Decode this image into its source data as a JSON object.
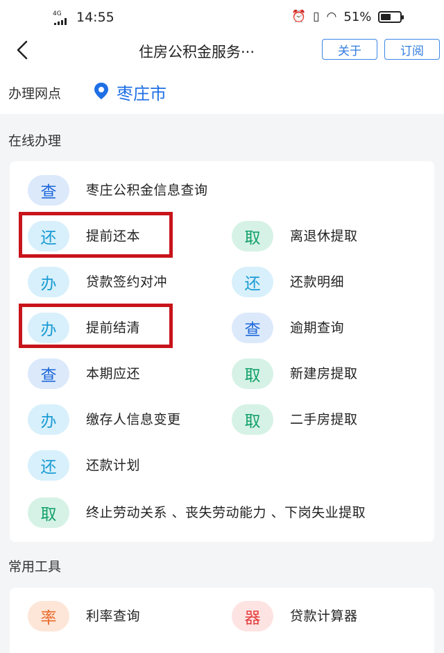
{
  "status_bar": {
    "time": "14:55",
    "network": "4G",
    "battery": "51%"
  },
  "nav": {
    "title": "住房公积金服务···",
    "about_label": "关于",
    "subscribe_label": "订阅"
  },
  "location": {
    "label": "办理网点",
    "city": "枣庄市"
  },
  "online": {
    "section_title": "在线办理",
    "items": [
      {
        "badge": "查",
        "label": "枣庄公积金信息查询"
      },
      {
        "badge": "还",
        "label": "提前还本"
      },
      {
        "badge": "取",
        "label": "离退休提取"
      },
      {
        "badge": "办",
        "label": "贷款签约对冲"
      },
      {
        "badge": "还",
        "label": "还款明细"
      },
      {
        "badge": "办",
        "label": "提前结清"
      },
      {
        "badge": "查",
        "label": "逾期查询"
      },
      {
        "badge": "查",
        "label": "本期应还"
      },
      {
        "badge": "取",
        "label": "新建房提取"
      },
      {
        "badge": "办",
        "label": "缴存人信息变更"
      },
      {
        "badge": "取",
        "label": "二手房提取"
      },
      {
        "badge": "还",
        "label": "还款计划"
      },
      {
        "badge": "取",
        "label": "终止劳动关系 、丧失劳动能力 、下岗失业提取"
      }
    ]
  },
  "tools": {
    "section_title": "常用工具",
    "items": [
      {
        "badge": "率",
        "label": "利率查询"
      },
      {
        "badge": "器",
        "label": "贷款计算器"
      }
    ]
  },
  "colors": {
    "accent": "#1f6fe5",
    "highlight": "#c8141b"
  }
}
